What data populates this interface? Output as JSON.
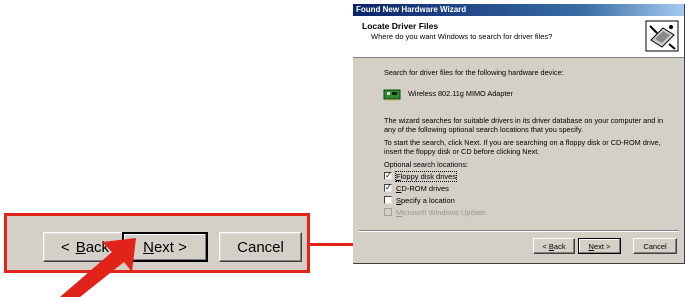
{
  "callout": {
    "back_prefix": "< ",
    "back_accel": "B",
    "back_rest": "ack",
    "next_accel": "N",
    "next_rest": "ext >",
    "cancel_label": "Cancel"
  },
  "dialog": {
    "title": "Found New Hardware Wizard",
    "header_title": "Locate Driver Files",
    "header_subtitle": "Where do you want Windows to search for driver files?",
    "intro": "Search for driver files for the following hardware device:",
    "device_name": "Wireless 802.11g MIMO Adapter",
    "para1": "The wizard searches for suitable drivers in its driver database on your computer and in any of the following optional search locations that you specify.",
    "para2": "To start the search, click Next. If you are searching on a floppy disk or CD-ROM drive, insert the floppy disk or CD before clicking Next.",
    "options_label": "Optional search locations:",
    "options": [
      {
        "pre": "",
        "accel": "F",
        "rest": "loppy disk drives",
        "checked": true
      },
      {
        "pre": "",
        "accel": "C",
        "rest": "D-ROM drives",
        "checked": true
      },
      {
        "pre": "",
        "accel": "S",
        "rest": "pecify a location",
        "checked": false
      },
      {
        "pre": "",
        "accel": "M",
        "rest": "icrosoft Windows Update",
        "checked": false
      }
    ],
    "back_prefix": "< ",
    "back_accel": "B",
    "back_rest": "ack",
    "next_accel": "N",
    "next_rest": "ext >",
    "cancel_label": "Cancel"
  },
  "colors": {
    "highlight": "#e2231a",
    "dialog_face": "#d4d0c8",
    "titlebar": "#0a246a"
  }
}
